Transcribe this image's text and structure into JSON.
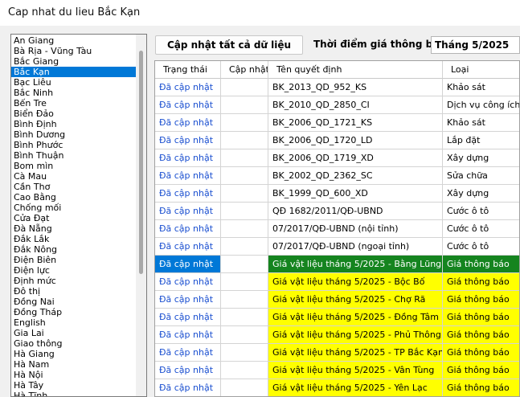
{
  "window": {
    "title": "Cap nhat du lieu Bắc Kạn"
  },
  "provinces": {
    "items": [
      "An Giang",
      "Bà Rịa - Vũng Tàu",
      "Bắc Giang",
      "Bắc Kạn",
      "Bạc Liêu",
      "Bắc Ninh",
      "Bến Tre",
      "Biển Đảo",
      "Bình Định",
      "Bình Dương",
      "Bình Phước",
      "Bình Thuận",
      "Bom mìn",
      "Cà Mau",
      "Cần Thơ",
      "Cao Bằng",
      "Chống mối",
      "Cửa Đạt",
      "Đà Nẵng",
      "Đắk Lắk",
      "Đắk Nông",
      "Điện Biên",
      "Điện lực",
      "Định mức",
      "Đô thị",
      "Đồng Nai",
      "Đồng Tháp",
      "English",
      "Gia Lai",
      "Giao thông",
      "Hà Giang",
      "Hà Nam",
      "Hà Nội",
      "Hà Tây",
      "Hà Tĩnh"
    ],
    "selected": "Bắc Kạn"
  },
  "toolbar": {
    "update_all_label": "Cập nhật tất cả dữ liệu",
    "time_label": "Thời điểm giá thông báo",
    "period_value": "Tháng 5/2025"
  },
  "grid": {
    "columns": [
      "Trạng thái",
      "Cập nhật",
      "Tên quyết định",
      "Loại"
    ],
    "rows": [
      {
        "status": "Đã cập nhật",
        "update": "",
        "name": "BK_2013_QD_952_KS",
        "type": "Khảo sát",
        "style": "normal"
      },
      {
        "status": "Đã cập nhật",
        "update": "",
        "name": "BK_2010_QD_2850_CI",
        "type": "Dịch vụ công ích",
        "style": "normal"
      },
      {
        "status": "Đã cập nhật",
        "update": "",
        "name": "BK_2006_QD_1721_KS",
        "type": "Khảo sát",
        "style": "normal"
      },
      {
        "status": "Đã cập nhật",
        "update": "",
        "name": "BK_2006_QD_1720_LD",
        "type": "Lắp đặt",
        "style": "normal"
      },
      {
        "status": "Đã cập nhật",
        "update": "",
        "name": "BK_2006_QD_1719_XD",
        "type": "Xây dựng",
        "style": "normal"
      },
      {
        "status": "Đã cập nhật",
        "update": "",
        "name": "BK_2002_QD_2362_SC",
        "type": "Sửa chữa",
        "style": "normal"
      },
      {
        "status": "Đã cập nhật",
        "update": "",
        "name": "BK_1999_QD_600_XD",
        "type": "Xây dựng",
        "style": "normal"
      },
      {
        "status": "Đã cập nhật",
        "update": "",
        "name": "QĐ 1682/2011/QĐ-UBND",
        "type": "Cước ô tô",
        "style": "normal"
      },
      {
        "status": "Đã cập nhật",
        "update": "",
        "name": "07/2017/QĐ-UBND (nội tỉnh)",
        "type": "Cước ô tô",
        "style": "normal"
      },
      {
        "status": "Đã cập nhật",
        "update": "",
        "name": "07/2017/QĐ-UBND (ngoại tỉnh)",
        "type": "Cước ô tô",
        "style": "normal"
      },
      {
        "status": "Đã cập nhật",
        "update": "",
        "name": "Giá vật liệu tháng 5/2025 - Bằng Lũng",
        "type": "Giá thông báo",
        "style": "selected"
      },
      {
        "status": "Đã cập nhật",
        "update": "",
        "name": "Giá vật liệu tháng 5/2025 - Bộc Bố",
        "type": "Giá thông báo",
        "style": "highlight"
      },
      {
        "status": "Đã cập nhật",
        "update": "",
        "name": "Giá vật liệu tháng 5/2025 - Chợ Rã",
        "type": "Giá thông báo",
        "style": "highlight"
      },
      {
        "status": "Đã cập nhật",
        "update": "",
        "name": "Giá vật liệu tháng 5/2025 - Đồng Tâm",
        "type": "Giá thông báo",
        "style": "highlight"
      },
      {
        "status": "Đã cập nhật",
        "update": "",
        "name": "Giá vật liệu tháng 5/2025 - Phủ Thông",
        "type": "Giá thông báo",
        "style": "highlight"
      },
      {
        "status": "Đã cập nhật",
        "update": "",
        "name": "Giá vật liệu tháng 5/2025 - TP Bắc Kạn",
        "type": "Giá thông báo",
        "style": "highlight"
      },
      {
        "status": "Đã cập nhật",
        "update": "",
        "name": "Giá vật liệu tháng 5/2025 - Vân Tùng",
        "type": "Giá thông báo",
        "style": "highlight"
      },
      {
        "status": "Đã cập nhật",
        "update": "",
        "name": "Giá vật liệu tháng 5/2025 - Yên Lạc",
        "type": "Giá thông báo",
        "style": "highlight"
      }
    ]
  },
  "colors": {
    "highlight": "#ffff00",
    "selected_name": "#15841f",
    "selection": "#0078d7",
    "status_text": "#1a4fd0"
  }
}
